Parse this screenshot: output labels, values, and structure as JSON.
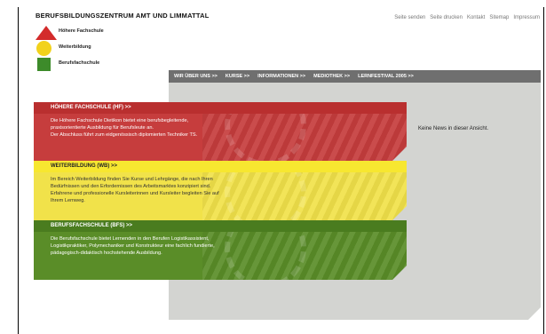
{
  "header": {
    "org_title": "BERUFSBILDUNGSZENTRUM AMT UND LIMMATTAL",
    "logo_labels": [
      "Höhere Fachschule",
      "Weiterbildung",
      "Berufsfachschule"
    ]
  },
  "top_links": [
    "Seite senden",
    "Seite drucken",
    "Kontakt",
    "Sitemap",
    "Impressum"
  ],
  "nav": [
    "WIR ÜBER UNS >>",
    "KURSE >>",
    "INFORMATIONEN >>",
    "MEDIOTHEK >>",
    "LERNFESTIVAL 2005 >>"
  ],
  "blocks": [
    {
      "title": "HÖHERE FACHSCHULE (HF) >>",
      "lines": [
        "Die Höhere Fachschule Dietikon bietet eine berufsbegleitende,",
        "praxisorientierte Ausbildung für Berufsleute an.",
        "Der Abschluss führt zum eidgenössisch diplomierten Techniker TS."
      ]
    },
    {
      "title": "WEITERBILDUNG (WB) >>",
      "lines": [
        "Im Bereich Weiterbildung finden Sie Kurse und Lehrgänge, die nach Ihren",
        "Bedürfnissen und den Erfordernissen des Arbeitsmarktes konzipiert sind.",
        "Erfahrene und professionelle Kursleiterinnen und Kursleiter begleiten Sie auf",
        "Ihrem Lernweg."
      ]
    },
    {
      "title": "BERUFSFACHSCHULE (BFS) >>",
      "lines": [
        "Die Berufsfachschule bietet Lernenden in den Berufen Logistikassistent,",
        "Logistikpraktiker, Polymechaniker und Konstrukteur eine fachlich fundierte,",
        "pädagogisch-didaktisch hochstehende Ausbildung."
      ]
    }
  ],
  "news": "Keine News in dieser Ansicht.",
  "colors": {
    "red": "#c63d3d",
    "yellow": "#f1e24a",
    "green": "#5a8d28",
    "nav": "#6f6f6f",
    "content_bg": "#d3d4d1"
  }
}
